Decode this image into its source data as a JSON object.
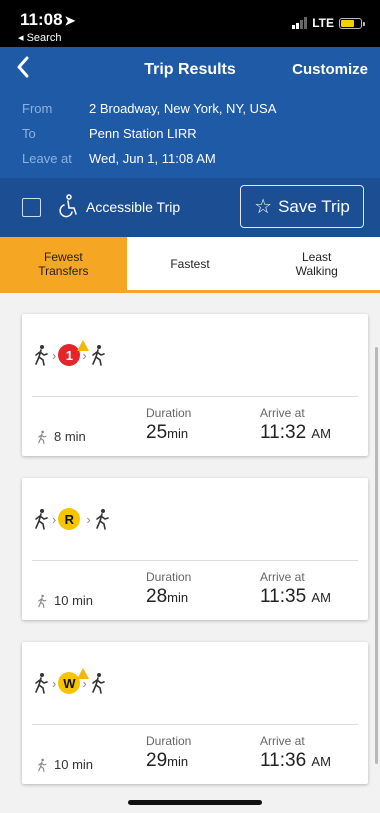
{
  "status": {
    "time": "11:08",
    "back_label": "◂ Search",
    "network": "LTE"
  },
  "header": {
    "back_icon": "chevron-left-icon",
    "title": "Trip Results",
    "customize": "Customize"
  },
  "trip": {
    "from_label": "From",
    "from_value": "2 Broadway, New York, NY, USA",
    "to_label": "To",
    "to_value": "Penn Station LIRR",
    "leave_label": "Leave at",
    "leave_value": "Wed, Jun 1, 11:08 AM"
  },
  "options": {
    "accessible_label": "Accessible Trip",
    "save_label": "Save Trip"
  },
  "tabs": [
    {
      "label": "Fewest\nTransfers",
      "active": true
    },
    {
      "label": "Fastest",
      "active": false
    },
    {
      "label": "Least\nWalking",
      "active": false
    }
  ],
  "results": [
    {
      "line": "1",
      "line_color": "#e3262b",
      "alert": true,
      "walk": "8 min",
      "duration_label": "Duration",
      "duration": "25",
      "duration_unit": "min",
      "arrive_label": "Arrive at",
      "arrive": "11:32",
      "arrive_ampm": "AM"
    },
    {
      "line": "R",
      "line_color": "#f7c500",
      "alert": false,
      "walk": "10 min",
      "duration_label": "Duration",
      "duration": "28",
      "duration_unit": "min",
      "arrive_label": "Arrive at",
      "arrive": "11:35",
      "arrive_ampm": "AM"
    },
    {
      "line": "W",
      "line_color": "#f7c500",
      "alert": true,
      "walk": "10 min",
      "duration_label": "Duration",
      "duration": "29",
      "duration_unit": "min",
      "arrive_label": "Arrive at",
      "arrive": "11:36",
      "arrive_ampm": "AM"
    }
  ],
  "colors": {
    "header_blue": "#1e5aa6",
    "options_blue": "#1b4e93",
    "tab_active": "#f5a623"
  }
}
